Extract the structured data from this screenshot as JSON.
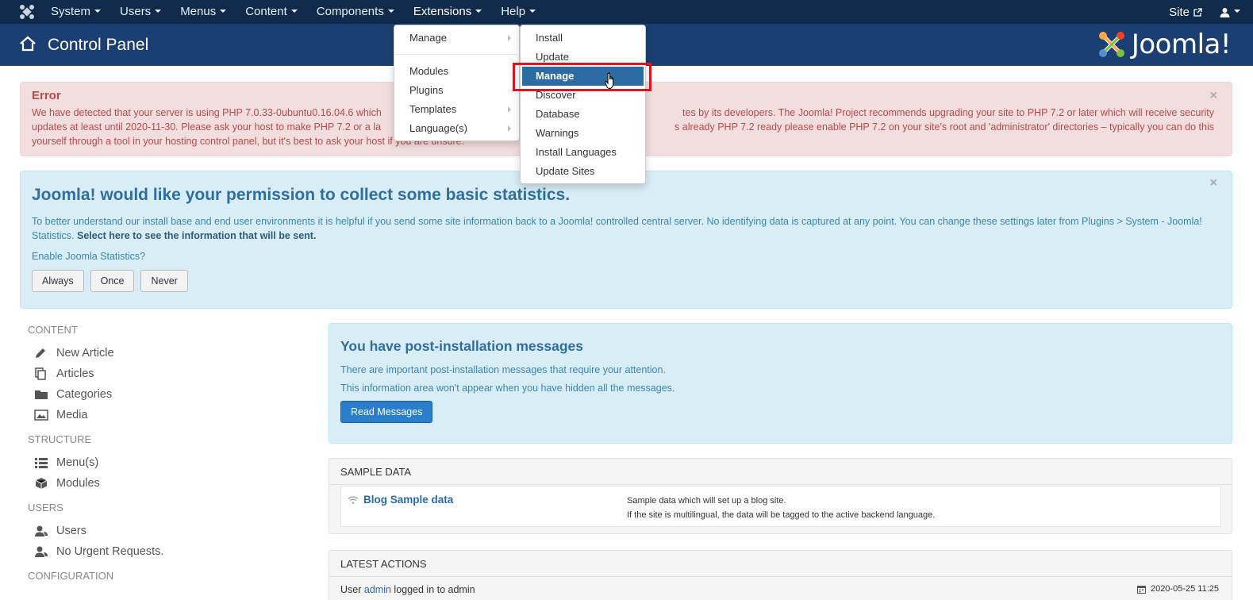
{
  "topnav": {
    "menus": [
      {
        "label": "System"
      },
      {
        "label": "Users"
      },
      {
        "label": "Menus"
      },
      {
        "label": "Content"
      },
      {
        "label": "Components"
      },
      {
        "label": "Extensions"
      },
      {
        "label": "Help"
      }
    ],
    "site_label": "Site"
  },
  "header": {
    "title": "Control Panel",
    "brand": "Joomla!"
  },
  "error": {
    "heading": "Error",
    "message": "We have detected that your server is using PHP 7.0.33-0ubuntu0.16.04.6 which",
    "message_2": "tes by its developers. The Joomla! Project recommends upgrading your site to PHP 7.2 or later which will receive security",
    "line2a": "updates at least until 2020-11-30. Please ask your host to make PHP 7.2 or a la",
    "line2b": "s already PHP 7.2 ready please enable PHP 7.2 on your site's root and 'administrator' directories – typically you can do this",
    "line3": "yourself through a tool in your hosting control panel, but it's best to ask your host if you are unsure."
  },
  "stats": {
    "heading": "Joomla! would like your permission to collect some basic statistics.",
    "text": "To better understand our install base and end user environments it is helpful if you send some site information back to a Joomla! controlled central server. No identifying data is captured at any point. You can change these settings later from Plugins > System - Joomla! Statistics.",
    "link_text": "Select here to see the information that will be sent.",
    "question": "Enable Joomla Statistics?",
    "buttons": {
      "always": "Always",
      "once": "Once",
      "never": "Never"
    }
  },
  "sidebar": {
    "content_title": "CONTENT",
    "new_article": "New Article",
    "articles": "Articles",
    "categories": "Categories",
    "media": "Media",
    "structure_title": "STRUCTURE",
    "menus": "Menu(s)",
    "modules": "Modules",
    "users_title": "USERS",
    "users": "Users",
    "no_urgent": "No Urgent Requests.",
    "config_title": "CONFIGURATION"
  },
  "post_install": {
    "heading": "You have post-installation messages",
    "p1": "There are important post-installation messages that require your attention.",
    "p2": "This information area won't appear when you have hidden all the messages.",
    "button": "Read Messages"
  },
  "sample_data": {
    "title": "SAMPLE DATA",
    "name": "Blog Sample data",
    "desc1": "Sample data which will set up a blog site.",
    "desc2": "If the site is multilingual, the data will be tagged to the active backend language."
  },
  "latest_actions": {
    "title": "LATEST ACTIONS",
    "prefix": "User",
    "user": "admin",
    "suffix": "logged in to admin",
    "date": "2020-05-25 11:25"
  },
  "extensions_menu": {
    "manage": "Manage",
    "modules": "Modules",
    "plugins": "Plugins",
    "templates": "Templates",
    "languages": "Language(s)"
  },
  "manage_submenu": {
    "install": "Install",
    "update": "Update",
    "manage": "Manage",
    "discover": "Discover",
    "database": "Database",
    "warnings": "Warnings",
    "install_languages": "Install Languages",
    "update_sites": "Update Sites"
  },
  "colors": {
    "topnav_bg": "#102a4c",
    "header_bg": "#1b3f72",
    "selected_item": "#2d6ca2",
    "highlight_box": "#e0141e"
  }
}
